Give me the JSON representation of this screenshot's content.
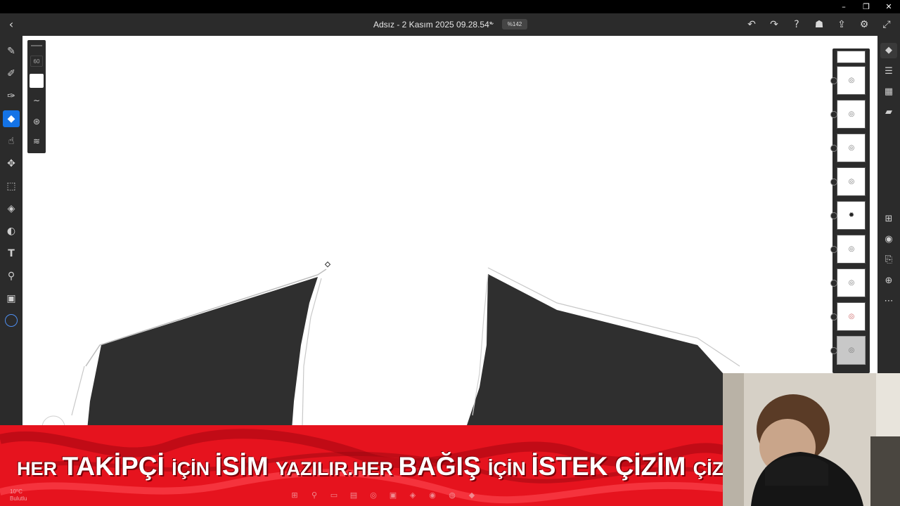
{
  "window": {
    "controls": {
      "minimize": "–",
      "restore": "❐",
      "close": "✕"
    }
  },
  "appbar": {
    "back_icon": "chevron-left-icon",
    "doc_title": "Adsız - 2 Kasım 2025 09.28.54*",
    "zoom": "%142",
    "actions": [
      "undo-icon",
      "redo-icon",
      "help-icon",
      "learn-icon",
      "share-icon",
      "settings-icon",
      "fullscreen-icon"
    ]
  },
  "tools": [
    {
      "name": "pixel-brush-icon",
      "active": false
    },
    {
      "name": "paint-brush-icon",
      "active": false
    },
    {
      "name": "mixer-brush-icon",
      "active": false
    },
    {
      "name": "eraser-icon",
      "active": true
    },
    {
      "name": "smudge-icon",
      "active": false
    },
    {
      "name": "move-icon",
      "active": false
    },
    {
      "name": "selection-icon",
      "active": false
    },
    {
      "name": "fill-icon",
      "active": false
    },
    {
      "name": "liquify-icon",
      "active": false
    },
    {
      "name": "text-icon",
      "active": false
    },
    {
      "name": "eyedropper-icon",
      "active": false
    },
    {
      "name": "image-icon",
      "active": false
    },
    {
      "name": "color-icon",
      "active": false
    }
  ],
  "brush_panel": {
    "size": "60",
    "color": "#ffffff"
  },
  "layers": {
    "count": 10,
    "selected_index": 9
  },
  "right_tools": [
    "layers-icon",
    "adjustments-icon",
    "grid-icon",
    "comments-icon",
    "add-layer-icon",
    "visibility-icon",
    "mask-icon",
    "blend-icon",
    "more-icon"
  ],
  "banner": {
    "parts": [
      {
        "text": "HER ",
        "size": "s"
      },
      {
        "text": "TAKİPÇİ ",
        "size": "l"
      },
      {
        "text": "İÇİN ",
        "size": "s"
      },
      {
        "text": "İSİM ",
        "size": "l"
      },
      {
        "text": "YAZILIR.HER ",
        "size": "s"
      },
      {
        "text": "BAĞIŞ ",
        "size": "l"
      },
      {
        "text": "İÇİN ",
        "size": "s"
      },
      {
        "text": "İSTEK ÇİZİM ",
        "size": "l"
      },
      {
        "text": "ÇİZİLİR",
        "size": "s"
      }
    ],
    "color": "#e6131e"
  },
  "taskbar": {
    "weather_temp": "10°C",
    "weather_desc": "Bulutlu"
  }
}
